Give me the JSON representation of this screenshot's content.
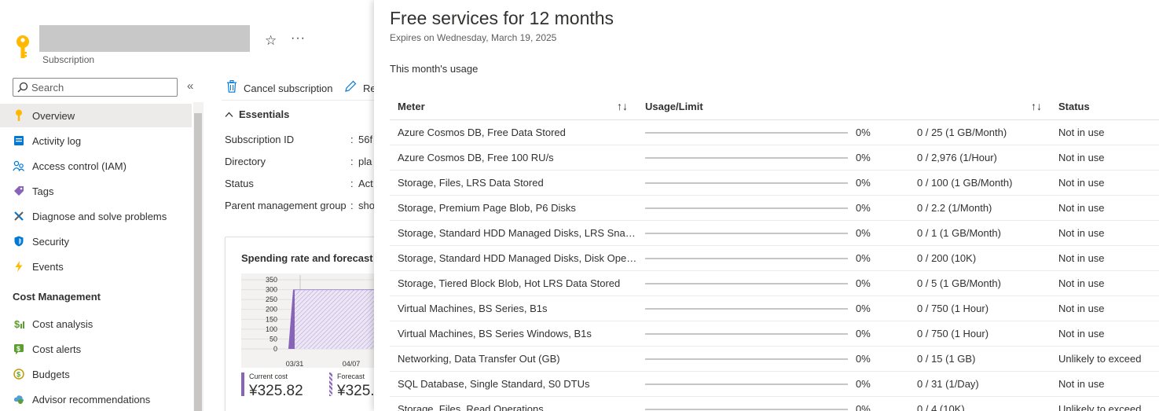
{
  "header": {
    "resource_type": "Subscription",
    "star_glyph": "☆",
    "more_glyph": "···"
  },
  "colors": {
    "accent": "#0078d4",
    "key_yellow": "#ffb900",
    "chart_purple": "#8764b8",
    "chart_fill": "#d8cdea"
  },
  "search": {
    "placeholder": "Search"
  },
  "nav": {
    "collapse_glyph": "«",
    "items": [
      {
        "label": "Overview",
        "icon": "key-icon",
        "active": true
      },
      {
        "label": "Activity log",
        "icon": "activity-log-icon"
      },
      {
        "label": "Access control (IAM)",
        "icon": "people-icon"
      },
      {
        "label": "Tags",
        "icon": "tag-icon"
      },
      {
        "label": "Diagnose and solve problems",
        "icon": "wrench-icon"
      },
      {
        "label": "Security",
        "icon": "shield-icon"
      },
      {
        "label": "Events",
        "icon": "lightning-icon"
      }
    ],
    "section_title": "Cost Management",
    "cost_items": [
      {
        "label": "Cost analysis",
        "icon": "cost-analysis-icon"
      },
      {
        "label": "Cost alerts",
        "icon": "cost-alerts-icon"
      },
      {
        "label": "Budgets",
        "icon": "budgets-icon"
      },
      {
        "label": "Advisor recommendations",
        "icon": "advisor-icon"
      }
    ]
  },
  "toolbar": {
    "cancel_label": "Cancel subscription",
    "rename_label": "Re"
  },
  "essentials": {
    "title": "Essentials",
    "rows": [
      {
        "label": "Subscription ID",
        "value": "56f"
      },
      {
        "label": "Directory",
        "value": "pla"
      },
      {
        "label": "Status",
        "value": "Act"
      },
      {
        "label": "Parent management group",
        "value": "sho"
      }
    ]
  },
  "spending_card": {
    "title": "Spending rate and forecast",
    "current_label": "Current cost",
    "current_value": "¥325.82",
    "forecast_label": "Forecast",
    "forecast_value": "¥325."
  },
  "chart_data": {
    "type": "area",
    "title": "Spending rate and forecast",
    "y_ticks": [
      "350",
      "300",
      "250",
      "200",
      "150",
      "100",
      "50",
      "0"
    ],
    "x_ticks": [
      "03/31",
      "04/07"
    ],
    "ylim": [
      0,
      350
    ],
    "series": [
      {
        "name": "Current cost",
        "x": [
          "03/31",
          "04/07"
        ],
        "values": [
          300,
          300
        ]
      }
    ]
  },
  "panel": {
    "title": "Free services for 12 months",
    "expires": "Expires on Wednesday, March 19, 2025",
    "usage_heading": "This month's usage",
    "sort_glyph": "↑↓",
    "columns": {
      "meter": "Meter",
      "usage": "Usage/Limit",
      "status": "Status"
    },
    "rows": [
      {
        "meter": "Azure Cosmos DB, Free Data Stored",
        "progress": 0,
        "percent": "0%",
        "limit": "0 / 25 (1 GB/Month)",
        "status": "Not in use"
      },
      {
        "meter": "Azure Cosmos DB, Free 100 RU/s",
        "progress": 0,
        "percent": "0%",
        "limit": "0 / 2,976 (1/Hour)",
        "status": "Not in use"
      },
      {
        "meter": "Storage, Files, LRS Data Stored",
        "progress": 0,
        "percent": "0%",
        "limit": "0 / 100 (1 GB/Month)",
        "status": "Not in use"
      },
      {
        "meter": "Storage, Premium Page Blob, P6 Disks",
        "progress": 0,
        "percent": "0%",
        "limit": "0 / 2.2 (1/Month)",
        "status": "Not in use"
      },
      {
        "meter": "Storage, Standard HDD Managed Disks, LRS Snaps...",
        "progress": 0,
        "percent": "0%",
        "limit": "0 / 1 (1 GB/Month)",
        "status": "Not in use"
      },
      {
        "meter": "Storage, Standard HDD Managed Disks, Disk Opera...",
        "progress": 0,
        "percent": "0%",
        "limit": "0 / 200 (10K)",
        "status": "Not in use"
      },
      {
        "meter": "Storage, Tiered Block Blob, Hot LRS Data Stored",
        "progress": 0,
        "percent": "0%",
        "limit": "0 / 5 (1 GB/Month)",
        "status": "Not in use"
      },
      {
        "meter": "Virtual Machines, BS Series, B1s",
        "progress": 0,
        "percent": "0%",
        "limit": "0 / 750 (1 Hour)",
        "status": "Not in use"
      },
      {
        "meter": "Virtual Machines, BS Series Windows, B1s",
        "progress": 0,
        "percent": "0%",
        "limit": "0 / 750 (1 Hour)",
        "status": "Not in use"
      },
      {
        "meter": "Networking, Data Transfer Out (GB)",
        "progress": 0,
        "percent": "0%",
        "limit": "0 / 15 (1 GB)",
        "status": "Unlikely to exceed"
      },
      {
        "meter": "SQL Database, Single Standard, S0 DTUs",
        "progress": 0,
        "percent": "0%",
        "limit": "0 / 31 (1/Day)",
        "status": "Not in use"
      },
      {
        "meter": "Storage, Files, Read Operations",
        "progress": 0,
        "percent": "0%",
        "limit": "0 / 4 (10K)",
        "status": "Unlikely to exceed"
      }
    ]
  }
}
